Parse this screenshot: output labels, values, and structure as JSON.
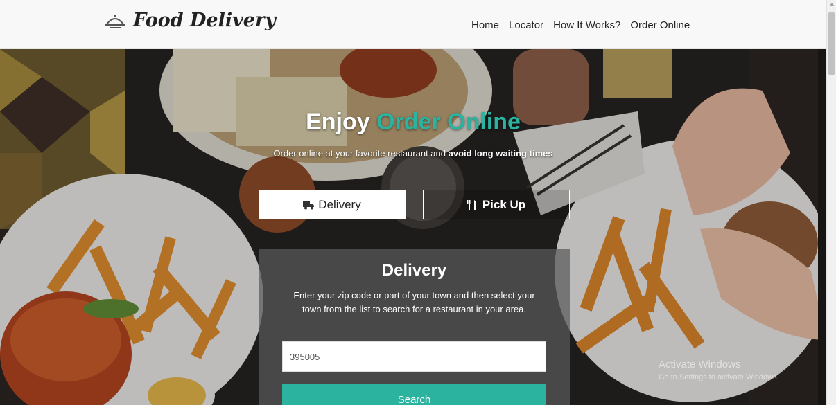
{
  "brand": {
    "name": "Food Delivery",
    "icon": "food-cloche-icon"
  },
  "nav": {
    "items": [
      "Home",
      "Locator",
      "How It Works?",
      "Order Online"
    ]
  },
  "hero": {
    "title_prefix": "Enjoy",
    "title_accent": "Order Online",
    "subtitle_plain": "Order online at your favorite restaurant and",
    "subtitle_bold": "avoid long waiting times",
    "delivery_tab": "Delivery",
    "pickup_tab": "Pick Up",
    "delivery_icon": "truck-icon",
    "pickup_icon": "fork-knife-icon"
  },
  "panel": {
    "title": "Delivery",
    "description": "Enter your zip code or part of your town and then select your town from the list to search for a restaurant in your area.",
    "zip_value": "395005",
    "search_label": "Search"
  },
  "watermark": {
    "title": "Activate Windows",
    "subtitle": "Go to Settings to activate Windows."
  },
  "colors": {
    "accent": "#2bb3a0",
    "header_bg": "#f8f8f8"
  }
}
